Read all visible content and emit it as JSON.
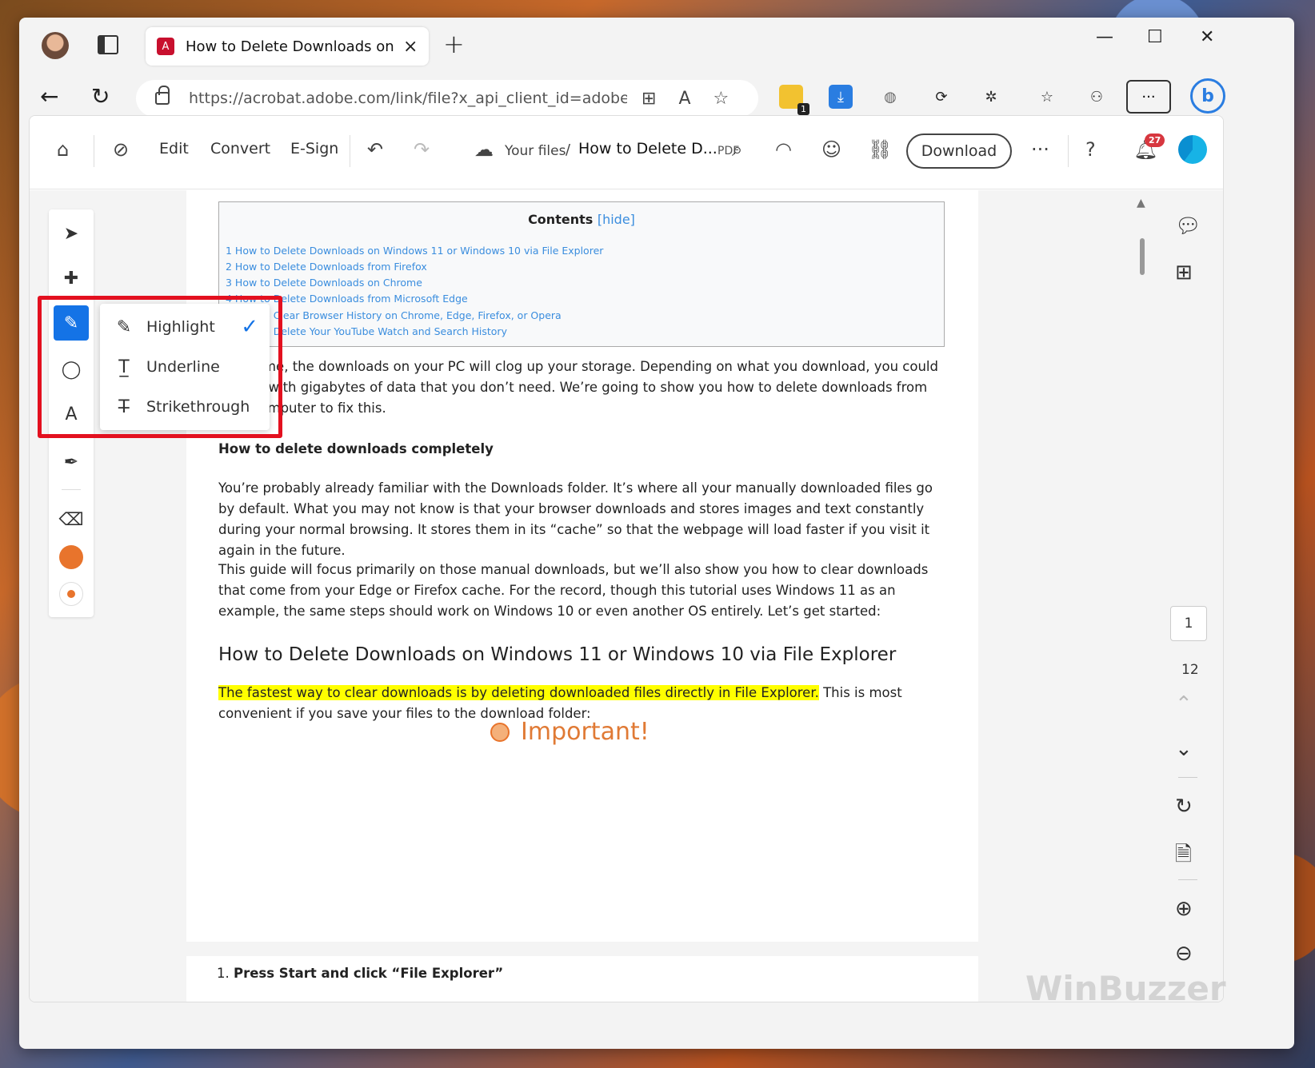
{
  "browser": {
    "tab_title": "How to Delete Downloads on Wi",
    "url": "https://acrobat.adobe.com/link/file?x_api_client_id=adobe_c...",
    "extension_badge": "1"
  },
  "toolbar": {
    "edit": "Edit",
    "convert": "Convert",
    "esign": "E-Sign",
    "your_files": "Your files",
    "slash": "/",
    "doc_title": "How to Delete D...",
    "pdf_label": "PDF",
    "download": "Download",
    "notification_count": "27"
  },
  "menu": {
    "items": [
      {
        "label": "Highlight",
        "selected": true
      },
      {
        "label": "Underline",
        "selected": false
      },
      {
        "label": "Strikethrough",
        "selected": false
      }
    ]
  },
  "colors": {
    "accent": "#1473e6",
    "annotation_color": "#e8742c",
    "highlight": "#ffff00",
    "callout_border": "#e3101f"
  },
  "doc": {
    "toc": {
      "title": "Contents",
      "hide_open": "[",
      "hide": "hide",
      "hide_close": "]",
      "items": [
        "1 How to Delete Downloads on Windows 11 or Windows 10 via File Explorer",
        "2 How to Delete Downloads from Firefox",
        "3 How to Delete Downloads on Chrome",
        "4 How to Delete Downloads from Microsoft Edge",
        "5 How to Clear Browser History on Chrome, Edge, Firefox, or Opera",
        "6 How to Delete Your YouTube Watch and Search History"
      ]
    },
    "intro": "Over time, the downloads on your PC will clog up your storage. Depending on what you download, you could end up with gigabytes of data that you don’t need. We’re going to show you how to delete downloads from your computer to fix this.",
    "subheading": "How to delete downloads completely",
    "para1": "You’re probably already familiar with the Downloads folder. It’s where all your manually downloaded files go by default. What you may not know is that your browser downloads and stores images and text constantly during your normal browsing. It stores them in its “cache” so that the webpage will load faster if you visit it again in the future.",
    "para2": "This guide will focus primarily on those manual downloads, but we’ll also show you how to clear downloads that come from your Edge or Firefox cache. For the record, though this tutorial uses Windows 11 as an example, the same steps should work on Windows 10 or even another OS entirely. Let’s get started:",
    "heading": "How to Delete Downloads on Windows 11 or Windows 10 via File Explorer",
    "highlighted": "The fastest way to clear downloads is by deleting downloaded files directly in File Explorer.",
    "after_highlight": " This is most convenient if you save your files to the download folder:",
    "sticky_note": "Important!",
    "step_number": "1.",
    "step_text": "Press Start and click “File Explorer”"
  },
  "pagination": {
    "current": "1",
    "total": "12"
  },
  "watermark": "WinBuzzer"
}
